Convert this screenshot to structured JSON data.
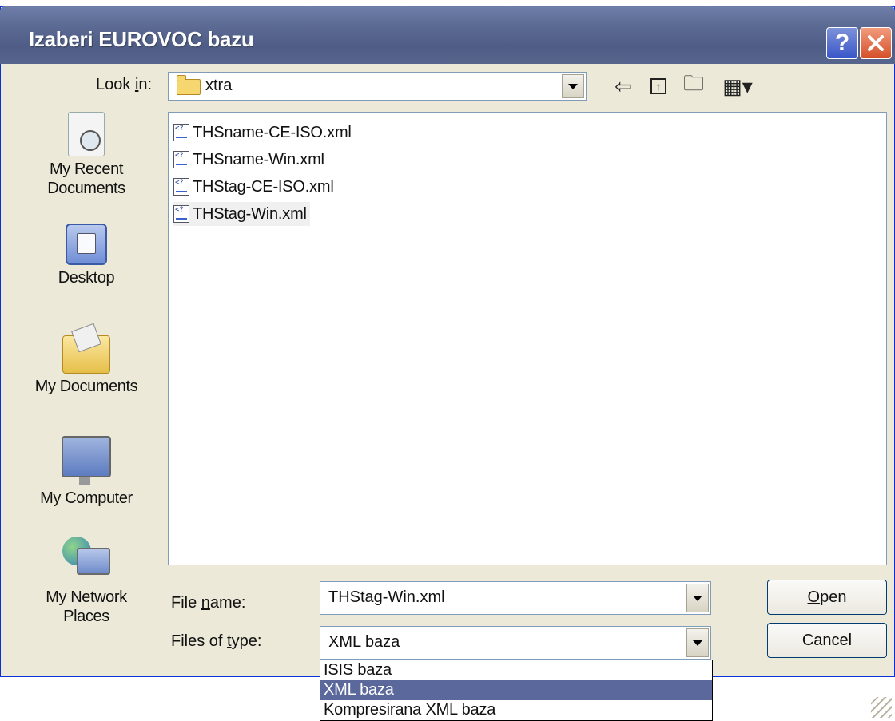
{
  "window": {
    "title": "Izaberi EUROVOC bazu",
    "help_label": "?"
  },
  "look_in": {
    "label_pre": "Look ",
    "label_accel": "i",
    "label_post": "n:",
    "value": "xtra"
  },
  "toolbar": {
    "back_icon": "back-arrow-icon",
    "up_icon": "up-folder-icon",
    "new_folder_icon": "new-folder-icon",
    "views_icon": "views-menu-icon"
  },
  "places": [
    {
      "label": "My Recent Documents",
      "line1": "My Recent",
      "line2": "Documents"
    },
    {
      "label": "Desktop"
    },
    {
      "label": "My Documents"
    },
    {
      "label": "My Computer"
    },
    {
      "label": "My Network Places",
      "line1": "My Network",
      "line2": "Places"
    }
  ],
  "files": [
    {
      "name": "THSname-CE-ISO.xml"
    },
    {
      "name": "THSname-Win.xml"
    },
    {
      "name": "THStag-CE-ISO.xml"
    },
    {
      "name": "THStag-Win.xml"
    }
  ],
  "file_name": {
    "label_pre": "File ",
    "label_accel": "n",
    "label_post": "ame:",
    "value": "THStag-Win.xml"
  },
  "file_type": {
    "label_pre": "Files of ",
    "label_accel": "t",
    "label_post": "ype:",
    "value": "XML baza",
    "options": [
      "ISIS baza",
      "XML baza",
      "Kompresirana XML baza"
    ],
    "selected_index": 1
  },
  "buttons": {
    "open_accel": "O",
    "open_rest": "pen",
    "cancel": "Cancel"
  },
  "colors": {
    "title_bar": "#5b6a93",
    "dialog_bg": "#ece9d8",
    "selection": "#5a689c"
  }
}
